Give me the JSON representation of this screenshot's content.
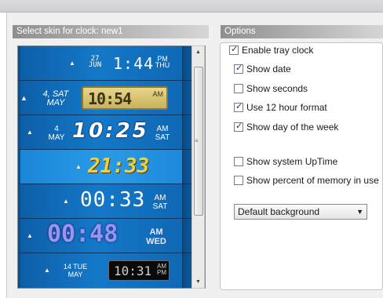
{
  "skins_header": "Select skin for clock: new1",
  "options_header": "Options",
  "skins": [
    {
      "date_top": "27",
      "date_bottom": "JUN",
      "time": "1:44",
      "ampm": "PM",
      "day": "THU"
    },
    {
      "date_top": "4, SAT",
      "date_bottom": "MAY",
      "time": "10:54",
      "ampm": "AM",
      "day": "SAT"
    },
    {
      "date_top": "4",
      "date_bottom": "MAY",
      "time": "10:25",
      "ampm": "AM",
      "day": "SAT"
    },
    {
      "time": "21:33"
    },
    {
      "time": "00:33",
      "ampm": "AM",
      "day": "SAT"
    },
    {
      "time": "00:48",
      "ampm": "AM",
      "day": "WED"
    },
    {
      "date_top": "14 TUE",
      "date_bottom": "MAY",
      "time": "10:31",
      "ampm": "AM",
      "day": "PM"
    }
  ],
  "options": {
    "enable_tray_clock": {
      "label": "Enable tray clock",
      "checked": true
    },
    "show_date": {
      "label": "Show date",
      "checked": true
    },
    "show_seconds": {
      "label": "Show seconds",
      "checked": false
    },
    "use_12_hour": {
      "label": "Use 12 hour format",
      "checked": true
    },
    "show_day": {
      "label": "Show day of the week",
      "checked": true
    },
    "show_uptime": {
      "label": "Show system UpTime",
      "checked": false
    },
    "show_memory": {
      "label": "Show percent of memory in use",
      "checked": false
    }
  },
  "background_select": {
    "value": "Default background"
  },
  "colors": {
    "accent_blue": "#1478c8",
    "yellow_lcd": "#f2d23a",
    "violet_text": "#8f88e8"
  }
}
